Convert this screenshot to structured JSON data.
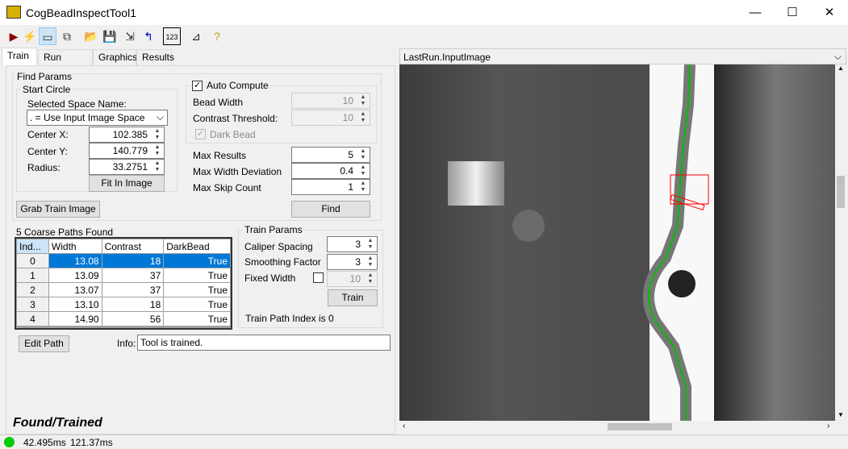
{
  "window": {
    "title": "CogBeadInspectTool1",
    "minimize": "—",
    "maximize": "☐",
    "close": "✕"
  },
  "toolbar": [
    {
      "icon": "run-icon",
      "glyph": "▶",
      "color": "#8b0000"
    },
    {
      "icon": "electric-icon",
      "glyph": "⚡",
      "color": "#e6c800"
    },
    {
      "icon": "show-panel-icon",
      "glyph": "▭",
      "color": "#333"
    },
    {
      "icon": "float-panel-icon",
      "glyph": "⧉",
      "color": "#333"
    },
    {
      "icon": "open-icon",
      "glyph": "📂",
      "color": "#c8a000"
    },
    {
      "icon": "save-icon",
      "glyph": "💾",
      "color": "#222"
    },
    {
      "icon": "save-as-icon",
      "glyph": "⇲",
      "color": "#222"
    },
    {
      "icon": "reset-icon",
      "glyph": "↰",
      "color": "#0000c0"
    },
    {
      "icon": "numeric-display-icon",
      "glyph": "123",
      "color": "#000"
    },
    {
      "icon": "graphics-tool-icon",
      "glyph": "⊿",
      "color": "#222"
    },
    {
      "icon": "help-icon",
      "glyph": "?",
      "color": "#c8a000"
    }
  ],
  "tabs": [
    "Train",
    "Run Params",
    "Graphics",
    "Results"
  ],
  "find_params": {
    "title": "Find Params",
    "start_circle": {
      "title": "Start Circle",
      "space_label": "Selected Space Name:",
      "space_value": ". = Use Input Image Space",
      "center_x_label": "Center X:",
      "center_x": "102.385",
      "center_y_label": "Center Y:",
      "center_y": "140.779",
      "radius_label": "Radius:",
      "radius": "33.2751",
      "fit_button": "Fit In Image"
    },
    "auto_compute": {
      "label": "Auto Compute",
      "checked": true,
      "bead_width_label": "Bead Width",
      "bead_width": "10",
      "contrast_label": "Contrast Threshold:",
      "contrast": "10",
      "dark_bead_label": "Dark Bead",
      "dark_bead_checked": true
    },
    "max_results_label": "Max Results",
    "max_results": "5",
    "max_width_dev_label": "Max Width Deviation",
    "max_width_dev": "0.4",
    "max_skip_label": "Max Skip Count",
    "max_skip": "1",
    "find_button": "Find",
    "grab_button": "Grab Train Image"
  },
  "paths": {
    "title": "5 Coarse Paths Found",
    "columns": [
      "Ind...",
      "Width",
      "Contrast",
      "DarkBead"
    ],
    "rows": [
      [
        "0",
        "13.08",
        "18",
        "True"
      ],
      [
        "1",
        "13.09",
        "37",
        "True"
      ],
      [
        "2",
        "13.07",
        "37",
        "True"
      ],
      [
        "3",
        "13.10",
        "18",
        "True"
      ],
      [
        "4",
        "14.90",
        "56",
        "True"
      ]
    ],
    "selected_row": 0
  },
  "train_params": {
    "title": "Train Params",
    "caliper_label": "Caliper Spacing",
    "caliper": "3",
    "smoothing_label": "Smoothing Factor",
    "smoothing": "3",
    "fixed_width_label": "Fixed Width",
    "fixed_width_checked": false,
    "fixed_width": "10",
    "train_button": "Train",
    "status": "Train Path Index is 0"
  },
  "edit_path_button": "Edit Path",
  "info_label": "Info:",
  "info_value": "Tool is trained.",
  "result_state": "Found/Trained",
  "image": {
    "selector": "LastRun.InputImage"
  },
  "statusbar": {
    "indicator_color": "#00cc00",
    "time1": "42.495ms",
    "time2": "121.37ms"
  },
  "colors": {
    "selection": "#0078d7",
    "graphic_box": "#ff0000",
    "path": "#00c000"
  }
}
